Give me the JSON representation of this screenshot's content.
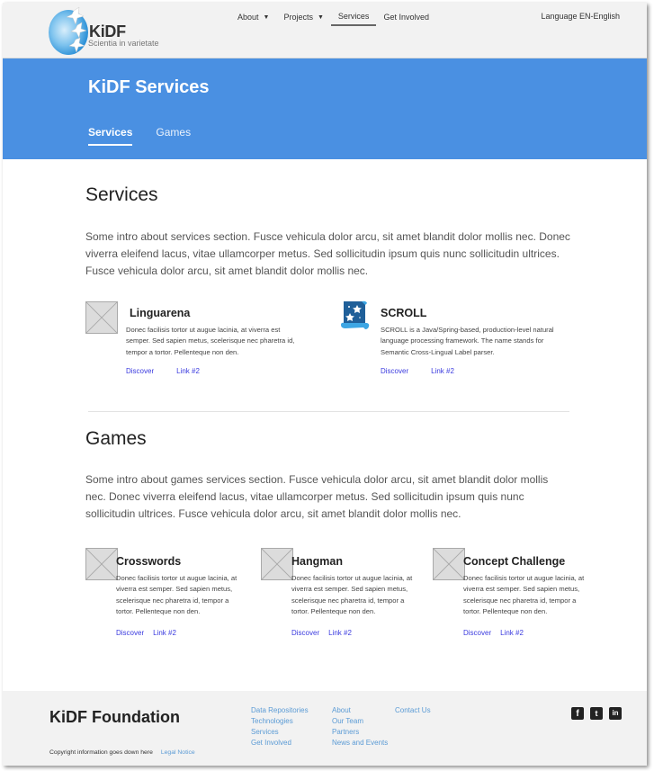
{
  "header": {
    "logo_text": "KiDF",
    "logo_tagline": "Scientia in varietate",
    "nav": [
      {
        "label": "About",
        "has_dropdown": true
      },
      {
        "label": "Projects",
        "has_dropdown": true
      },
      {
        "label": "Services",
        "has_dropdown": false,
        "active": true
      },
      {
        "label": "Get Involved",
        "has_dropdown": false
      }
    ],
    "language": "Language EN-English"
  },
  "hero": {
    "title": "KiDF Services",
    "tabs": [
      {
        "label": "Services",
        "active": true
      },
      {
        "label": "Games",
        "active": false
      }
    ],
    "color": "#4a90e2"
  },
  "services": {
    "title": "Services",
    "intro": "Some intro about services section. Fusce vehicula dolor arcu, sit amet blandit dolor mollis nec. Donec viverra eleifend lacus, vitae ullamcorper metus. Sed sollicitudin ipsum quis nunc sollicitudin ultrices. Fusce vehicula dolor arcu, sit amet blandit dolor mollis nec.",
    "items": [
      {
        "title": "Linguarena",
        "icon": "image-placeholder-icon",
        "description": "Donec facilisis tortor ut augue lacinia, at viverra est semper. Sed sapien metus, scelerisque nec pharetra id, tempor a tortor. Pellenteque non den.",
        "links": [
          "Discover",
          "Link #2"
        ]
      },
      {
        "title": "SCROLL",
        "icon": "scroll-stars-icon",
        "description": "SCROLL is a Java/Spring-based, production-level natural language processing framework. The name stands for Semantic Cross-Lingual Label parser.",
        "links": [
          "Discover",
          "Link #2"
        ]
      }
    ]
  },
  "games": {
    "title": "Games",
    "intro": "Some intro about games services section. Fusce vehicula dolor arcu, sit amet blandit dolor mollis nec. Donec viverra eleifend lacus, vitae ullamcorper metus. Sed sollicitudin ipsum quis nunc sollicitudin ultrices. Fusce vehicula dolor arcu, sit amet blandit dolor mollis nec.",
    "items": [
      {
        "title": "Crosswords",
        "icon": "image-placeholder-icon",
        "description": "Donec facilisis tortor ut augue lacinia, at viverra est semper. Sed sapien metus, scelerisque nec pharetra id, tempor a tortor. Pellenteque non den.",
        "links": [
          "Discover",
          "Link #2"
        ]
      },
      {
        "title": "Hangman",
        "icon": "image-placeholder-icon",
        "description": "Donec facilisis tortor ut augue lacinia, at viverra est semper. Sed sapien metus, scelerisque nec pharetra id, tempor a tortor. Pellenteque non den.",
        "links": [
          "Discover",
          "Link #2"
        ]
      },
      {
        "title": "Concept Challenge",
        "icon": "image-placeholder-icon",
        "description": "Donec facilisis tortor ut augue lacinia, at viverra est semper. Sed sapien metus, scelerisque nec pharetra id, tempor a tortor. Pellenteque non den.",
        "links": [
          "Discover",
          "Link #2"
        ]
      }
    ]
  },
  "footer": {
    "brand": "KiDF Foundation",
    "columns": [
      [
        "Data Repositories",
        "Technologies",
        "Services",
        "Get Involved"
      ],
      [
        "About",
        "Our Team",
        "Partners",
        "News and Events"
      ],
      [
        "Contact Us"
      ]
    ],
    "copyright": "Copyright information goes down here",
    "legal": "Legal Notice",
    "social": [
      {
        "icon": "facebook-icon",
        "glyph": "f"
      },
      {
        "icon": "twitter-icon",
        "glyph": "t"
      },
      {
        "icon": "linkedin-icon",
        "glyph": "in"
      }
    ]
  }
}
